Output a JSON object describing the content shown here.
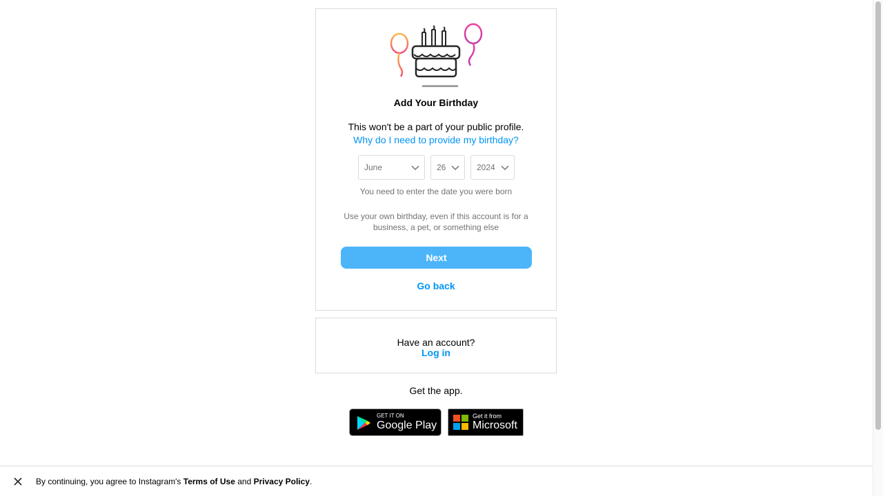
{
  "signup": {
    "title": "Add Your Birthday",
    "subtitle": "This won't be a part of your public profile.",
    "why_link": "Why do I need to provide my birthday?",
    "month": "June",
    "day": "26",
    "year": "2024",
    "hint": "You need to enter the date you were born",
    "hint2": "Use your own birthday, even if this account is for a business, a pet, or something else",
    "next_label": "Next",
    "go_back_label": "Go back"
  },
  "login_box": {
    "prompt": "Have an account?",
    "login_label": "Log in"
  },
  "app": {
    "get_app": "Get the app.",
    "google_small": "GET IT ON",
    "google_big": "Google Play",
    "ms_small": "Get it from",
    "ms_big": "Microsoft"
  },
  "footer": {
    "prefix": "By continuing, you agree to Instagram's ",
    "terms": "Terms of Use",
    "and": " and ",
    "privacy": "Privacy Policy",
    "suffix": "."
  },
  "icons": {
    "illustration": "birthday-cake-balloons-icon",
    "chevron": "chevron-down-icon",
    "close": "close-icon",
    "play": "google-play-icon",
    "ms": "microsoft-logo-icon"
  },
  "colors": {
    "accent": "#0095f6",
    "button": "#4cb5f9",
    "border": "#dbdbdb",
    "muted": "#737373"
  }
}
